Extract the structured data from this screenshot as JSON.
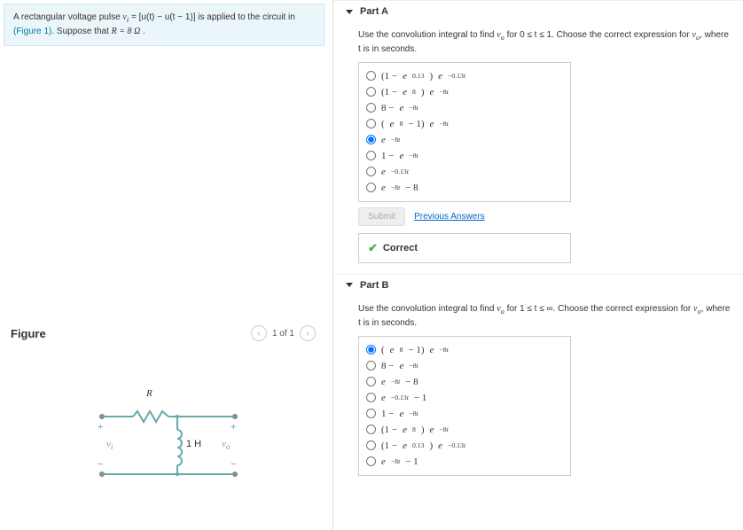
{
  "problem": {
    "text_pre": "A rectangular voltage pulse ",
    "vi": "v",
    "vi_sub": "i",
    "eq": " = [u(t) − u(t − 1)] is applied to the circuit in ",
    "fig_link": "(Figure 1)",
    "text_post": ". Suppose that ",
    "r_expr": "R = 8 Ω",
    "period": " ."
  },
  "figure": {
    "title": "Figure",
    "counter": "1 of 1",
    "labels": {
      "R": "R",
      "L": "1 H",
      "vi": "v",
      "vi_sub": "i",
      "vo": "v",
      "vo_sub": "o",
      "plus": "+",
      "minus": "−"
    }
  },
  "partA": {
    "title": "Part A",
    "prompt_pre": "Use the convolution integral to find ",
    "vo": "v",
    "vo_sub": "o",
    "prompt_mid": " for 0 ≤ t ≤ 1. Choose the correct expression for ",
    "prompt_post": ", where t is in seconds.",
    "options": [
      "(1 − e^{0.13})e^{−0.13t}",
      "(1 − e^{8})e^{−8t}",
      "8 − e^{−8t}",
      "(e^{8} − 1)e^{−8t}",
      "e^{−8t}",
      "1 − e^{−8t}",
      "e^{−0.13t}",
      "e^{−8t} − 8"
    ],
    "selected": 4,
    "submit": "Submit",
    "prev": "Previous Answers",
    "correct": "Correct"
  },
  "partB": {
    "title": "Part B",
    "prompt_pre": "Use the convolution integral to find ",
    "vo": "v",
    "vo_sub": "o",
    "prompt_mid": " for 1 ≤ t ≤ ∞. Choose the correct expression for ",
    "prompt_post": ", where t is in seconds.",
    "options": [
      "(e^{8} − 1)e^{−8t}",
      "8 − e^{−8t}",
      "e^{−8t} − 8",
      "e^{−0.13t} − 1",
      "1 − e^{−8t}",
      "(1 − e^{8})e^{−8t}",
      "(1 − e^{0.13})e^{−0.13t}",
      "e^{−8t} − 1"
    ],
    "selected": 0
  }
}
